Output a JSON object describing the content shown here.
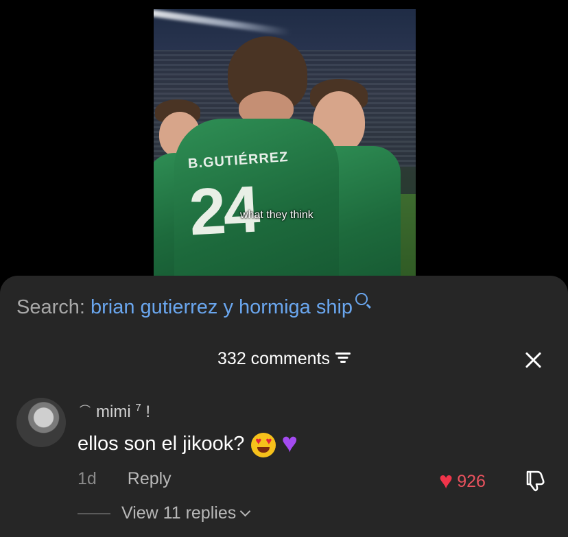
{
  "video": {
    "caption": "what they think",
    "jersey_name": "B.GUTIÉRREZ",
    "jersey_number": "24"
  },
  "search": {
    "label": "Search:",
    "query": "brian gutierrez y hormiga ship",
    "icon": "search-icon"
  },
  "comments": {
    "count_label": "332 comments",
    "filter_icon": "filter-icon",
    "close_icon": "close-icon",
    "items": [
      {
        "username": "mimi",
        "superscript": "7",
        "suffix": "!",
        "text": "ellos son el jikook?",
        "emojis": [
          "heart-eyes-emoji",
          "purple-heart-emoji"
        ],
        "time": "1d",
        "reply_label": "Reply",
        "likes": "926",
        "view_replies_label": "View 11 replies"
      }
    ]
  },
  "colors": {
    "accent_blue": "#6aa6ee",
    "like_red": "#f0344a",
    "sheet_bg": "#262626"
  }
}
